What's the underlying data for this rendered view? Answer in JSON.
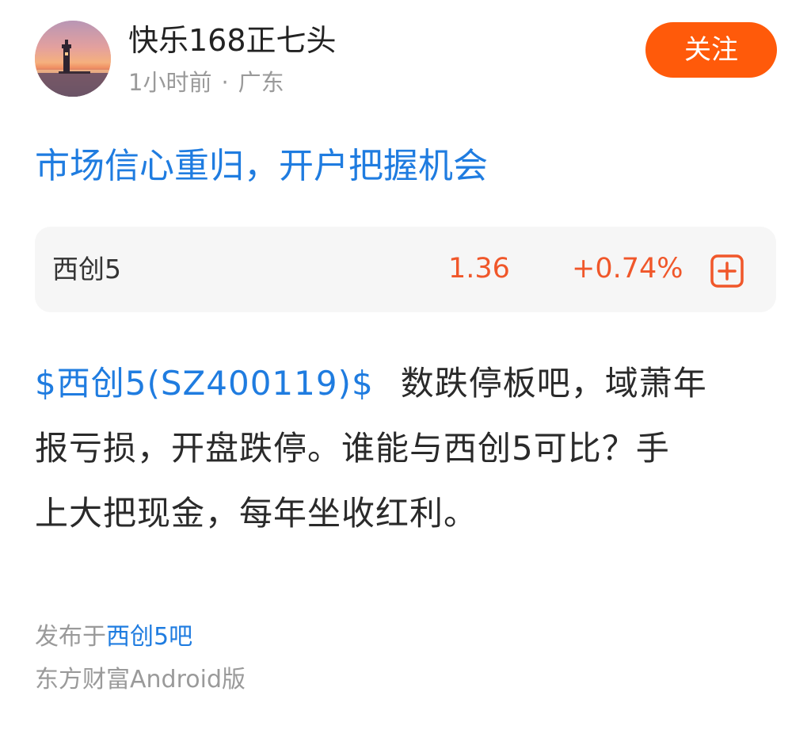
{
  "header": {
    "username": "快乐168正七头",
    "time": "1小时前",
    "separator": "·",
    "location": "广东",
    "follow_label": "关注",
    "follow_color": "#ff5a0a"
  },
  "post": {
    "title": "市场信心重归，开户把握机会",
    "stock_tag": "$西创5(SZ400119)$",
    "body_line1": "数跌停板吧，域萧年",
    "body_line2": "报亏损，开盘跌停。谁能与西创5可比？手",
    "body_line3": "上大把现金，每年坐收红利。"
  },
  "stock_card": {
    "name": "西创5",
    "price": "1.36",
    "change": "+0.74%",
    "add_icon": "plus-square-icon",
    "color_up": "#f0572a"
  },
  "footer": {
    "published_prefix": "发布于",
    "bar_name": "西创5吧",
    "client": "东方财富Android版"
  },
  "colors": {
    "link": "#1f7ce0",
    "muted": "#9a9a9a",
    "card_bg": "#f6f6f6"
  }
}
